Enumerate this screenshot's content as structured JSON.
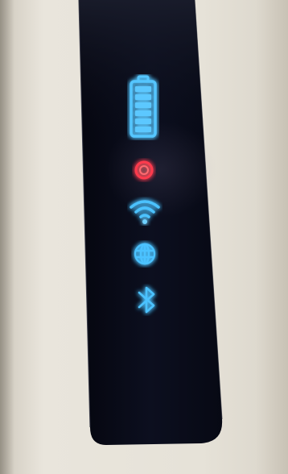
{
  "scene": {
    "description_icons": [
      "battery-icon",
      "power-icon",
      "wifi-icon",
      "globe-icon",
      "bluetooth-icon"
    ],
    "colors": {
      "wall": "#e6e2d8",
      "panel": "#0a0c1a",
      "blue_led": "#3fb0ff",
      "red_led": "#ff3a4a"
    },
    "battery_level": 1.0
  }
}
